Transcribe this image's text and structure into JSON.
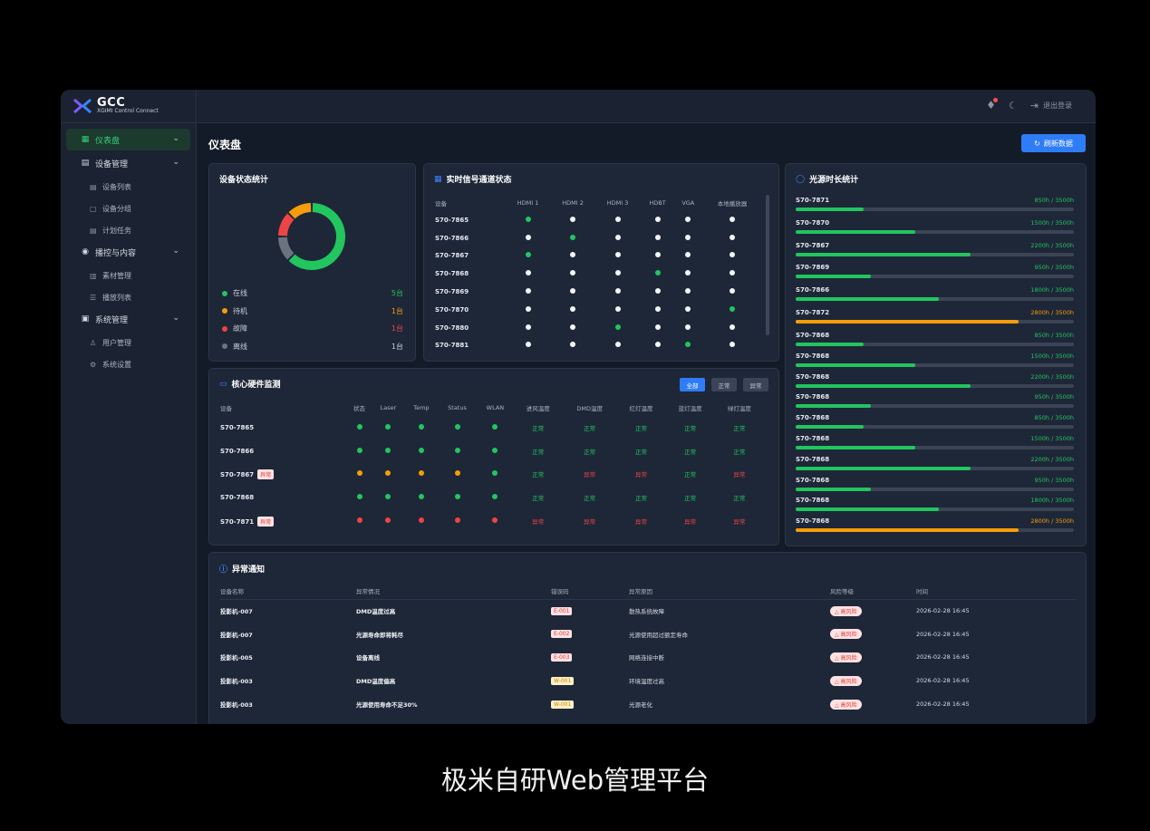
{
  "app": {
    "logo_title": "GCC",
    "logo_subtitle": "XGIMI Control Connect",
    "logout": "退出登录"
  },
  "sidebar": {
    "items": [
      {
        "label": "仪表盘",
        "icon": "dashboard-icon",
        "active": true
      },
      {
        "label": "设备管理",
        "icon": "device-icon",
        "children": [
          {
            "label": "设备列表",
            "icon": "list-icon"
          },
          {
            "label": "设备分组",
            "icon": "group-icon"
          },
          {
            "label": "计划任务",
            "icon": "task-icon"
          }
        ]
      },
      {
        "label": "播控与内容",
        "icon": "play-icon",
        "children": [
          {
            "label": "素材管理",
            "icon": "media-icon"
          },
          {
            "label": "播放列表",
            "icon": "playlist-icon"
          }
        ]
      },
      {
        "label": "系统管理",
        "icon": "system-icon",
        "children": [
          {
            "label": "用户管理",
            "icon": "users-icon"
          },
          {
            "label": "系统设置",
            "icon": "settings-icon"
          }
        ]
      }
    ]
  },
  "page": {
    "title": "仪表盘",
    "refresh": "刷新数据"
  },
  "status_card": {
    "title": "设备状态统计",
    "legend": [
      {
        "label": "在线",
        "value": "5台",
        "count": 5,
        "color": "#22c55e"
      },
      {
        "label": "待机",
        "value": "1台",
        "count": 1,
        "color": "#f59e0b"
      },
      {
        "label": "故障",
        "value": "1台",
        "count": 1,
        "color": "#ef4444"
      },
      {
        "label": "离线",
        "value": "1台",
        "count": 1,
        "color": "#6b7280"
      }
    ]
  },
  "signal_card": {
    "title": "实时信号通道状态",
    "columns": [
      "设备",
      "HDMI 1",
      "HDMI 2",
      "HDMI 3",
      "HDBT",
      "VGA",
      "本地播放器"
    ],
    "rows": [
      {
        "device": "S70-7865",
        "states": [
          "g",
          "w",
          "w",
          "w",
          "w",
          "w"
        ]
      },
      {
        "device": "S70-7866",
        "states": [
          "w",
          "g",
          "w",
          "w",
          "w",
          "w"
        ]
      },
      {
        "device": "S70-7867",
        "states": [
          "g",
          "w",
          "w",
          "w",
          "w",
          "w"
        ]
      },
      {
        "device": "S70-7868",
        "states": [
          "w",
          "w",
          "w",
          "g",
          "w",
          "w"
        ]
      },
      {
        "device": "S70-7869",
        "states": [
          "w",
          "w",
          "w",
          "w",
          "w",
          "w"
        ]
      },
      {
        "device": "S70-7870",
        "states": [
          "w",
          "w",
          "w",
          "w",
          "w",
          "g"
        ]
      },
      {
        "device": "S70-7880",
        "states": [
          "w",
          "w",
          "g",
          "w",
          "w",
          "w"
        ]
      },
      {
        "device": "S70-7881",
        "states": [
          "w",
          "w",
          "w",
          "w",
          "g",
          "w"
        ]
      }
    ]
  },
  "hardware_card": {
    "title": "核心硬件监测",
    "filters": [
      "全部",
      "正常",
      "异常"
    ],
    "columns": [
      "设备",
      "状态",
      "Laser",
      "Temp",
      "Status",
      "WLAN",
      "进风温度",
      "DMD温度",
      "红灯温度",
      "蓝灯温度",
      "绿灯温度"
    ],
    "rows": [
      {
        "device": "S70-7865",
        "tag": "",
        "dots": [
          "g",
          "g",
          "g",
          "g",
          "g"
        ],
        "temps": [
          "正常",
          "正常",
          "正常",
          "正常",
          "正常"
        ],
        "temp_ok": [
          true,
          true,
          true,
          true,
          true
        ]
      },
      {
        "device": "S70-7866",
        "tag": "",
        "dots": [
          "g",
          "g",
          "g",
          "g",
          "g"
        ],
        "temps": [
          "正常",
          "正常",
          "正常",
          "正常",
          "正常"
        ],
        "temp_ok": [
          true,
          true,
          true,
          true,
          true
        ]
      },
      {
        "device": "S70-7867",
        "tag": "异常",
        "dots": [
          "o",
          "o",
          "o",
          "o",
          "g"
        ],
        "temps": [
          "正常",
          "异常",
          "异常",
          "正常",
          "异常"
        ],
        "temp_ok": [
          true,
          false,
          false,
          true,
          false
        ]
      },
      {
        "device": "S70-7868",
        "tag": "",
        "dots": [
          "g",
          "g",
          "g",
          "g",
          "g"
        ],
        "temps": [
          "正常",
          "正常",
          "正常",
          "正常",
          "正常"
        ],
        "temp_ok": [
          true,
          true,
          true,
          true,
          true
        ]
      },
      {
        "device": "S70-7871",
        "tag": "异常",
        "dots": [
          "r",
          "r",
          "r",
          "r",
          "r"
        ],
        "temps": [
          "异常",
          "异常",
          "异常",
          "异常",
          "异常"
        ],
        "temp_ok": [
          false,
          false,
          false,
          false,
          false
        ]
      }
    ]
  },
  "lamp_card": {
    "title": "光源时长统计",
    "rows": [
      {
        "device": "S70-7871",
        "hours": "850h / 3500h",
        "used": 850,
        "total": 3500,
        "color": "#22c55e"
      },
      {
        "device": "S70-7870",
        "hours": "1500h / 3500h",
        "used": 1500,
        "total": 3500,
        "color": "#22c55e"
      },
      {
        "device": "S70-7867",
        "hours": "2200h / 3500h",
        "used": 2200,
        "total": 3500,
        "color": "#22c55e"
      },
      {
        "device": "S70-7869",
        "hours": "950h / 3500h",
        "used": 950,
        "total": 3500,
        "color": "#22c55e"
      },
      {
        "device": "S70-7866",
        "hours": "1800h / 3500h",
        "used": 1800,
        "total": 3500,
        "color": "#22c55e"
      },
      {
        "device": "S70-7872",
        "hours": "2800h / 3500h",
        "used": 2800,
        "total": 3500,
        "color": "#f59e0b"
      },
      {
        "device": "S70-7868",
        "hours": "850h / 3500h",
        "used": 850,
        "total": 3500,
        "color": "#22c55e"
      },
      {
        "device": "S70-7868",
        "hours": "1500h / 3500h",
        "used": 1500,
        "total": 3500,
        "color": "#22c55e"
      },
      {
        "device": "S70-7868",
        "hours": "2200h / 3500h",
        "used": 2200,
        "total": 3500,
        "color": "#22c55e"
      },
      {
        "device": "S70-7868",
        "hours": "950h / 3500h",
        "used": 950,
        "total": 3500,
        "color": "#22c55e"
      },
      {
        "device": "S70-7868",
        "hours": "850h / 3500h",
        "used": 850,
        "total": 3500,
        "color": "#22c55e"
      },
      {
        "device": "S70-7868",
        "hours": "1500h / 3500h",
        "used": 1500,
        "total": 3500,
        "color": "#22c55e"
      },
      {
        "device": "S70-7868",
        "hours": "2200h / 3500h",
        "used": 2200,
        "total": 3500,
        "color": "#22c55e"
      },
      {
        "device": "S70-7868",
        "hours": "950h / 3500h",
        "used": 950,
        "total": 3500,
        "color": "#22c55e"
      },
      {
        "device": "S70-7868",
        "hours": "1800h / 3500h",
        "used": 1800,
        "total": 3500,
        "color": "#22c55e"
      },
      {
        "device": "S70-7868",
        "hours": "2800h / 3500h",
        "used": 2800,
        "total": 3500,
        "color": "#f59e0b"
      }
    ]
  },
  "alerts_card": {
    "title": "异常通知",
    "columns": [
      "设备名称",
      "异常情况",
      "错误码",
      "异常原因",
      "风险等级",
      "时间"
    ],
    "rows": [
      {
        "name": "投影机-007",
        "issue": "DMD温度过高",
        "code": "E-001",
        "code_type": "e",
        "reason": "散热系统故障",
        "risk": "高风险",
        "time": "2026-02-28  16:45"
      },
      {
        "name": "投影机-007",
        "issue": "光源寿命即将耗尽",
        "code": "E-002",
        "code_type": "e",
        "reason": "光源使用超过额定寿命",
        "risk": "高风险",
        "time": "2026-02-28  16:45"
      },
      {
        "name": "投影机-005",
        "issue": "设备离线",
        "code": "E-003",
        "code_type": "e",
        "reason": "网络连接中断",
        "risk": "高风险",
        "time": "2026-02-28  16:45"
      },
      {
        "name": "投影机-003",
        "issue": "DMD温度偏高",
        "code": "W-001",
        "code_type": "w",
        "reason": "环境温度过高",
        "risk": "高风险",
        "time": "2026-02-28  16:45"
      },
      {
        "name": "投影机-003",
        "issue": "光源使用寿命不足30%",
        "code": "W-001",
        "code_type": "w",
        "reason": "光源老化",
        "risk": "高风险",
        "time": "2026-02-28  16:45"
      }
    ]
  },
  "caption": "极米自研Web管理平台"
}
